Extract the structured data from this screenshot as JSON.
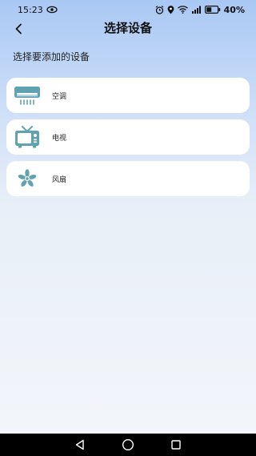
{
  "status_bar": {
    "time": "15:23",
    "battery": "40%"
  },
  "header": {
    "title": "选择设备"
  },
  "section_label": "选择要添加的设备",
  "devices": [
    {
      "label": "空调",
      "icon": "air-conditioner-icon"
    },
    {
      "label": "电视",
      "icon": "tv-icon"
    },
    {
      "label": "风扇",
      "icon": "fan-icon"
    }
  ],
  "colors": {
    "icon_teal": "#5fa3b1",
    "card_bg": "#ffffff",
    "nav_bg": "#000000"
  }
}
